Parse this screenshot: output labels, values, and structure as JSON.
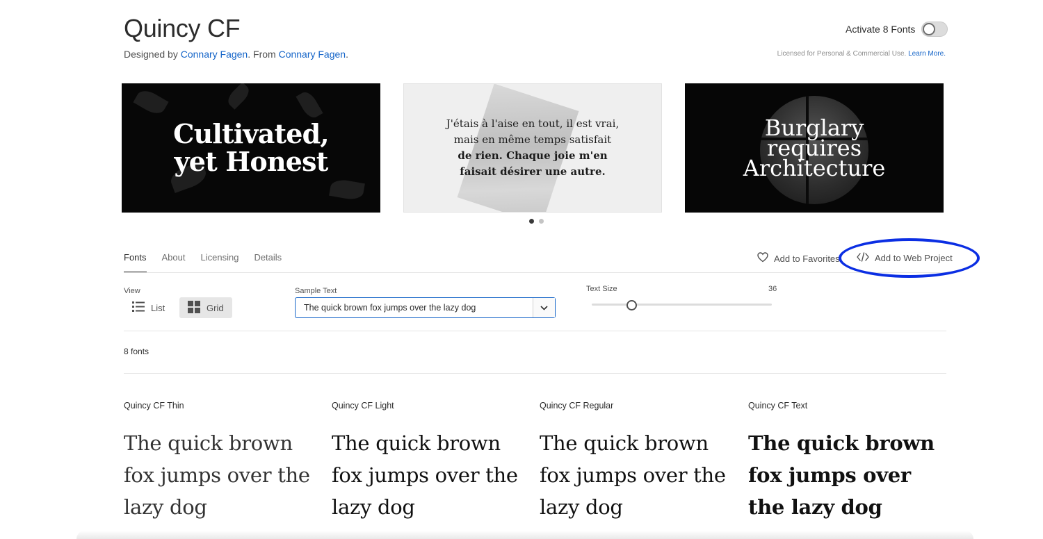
{
  "header": {
    "title": "Quincy CF",
    "designed_by_prefix": "Designed by ",
    "designer": "Connary Fagen",
    "from_prefix": ". From ",
    "foundry": "Connary Fagen",
    "suffix": ".",
    "activate_label": "Activate 8 Fonts",
    "activate_on": false,
    "license_text": "Licensed for Personal & Commercial Use. ",
    "learn_more": "Learn More."
  },
  "carousel": {
    "slides": [
      {
        "line1": "Cultivated,",
        "line2": "yet Honest"
      },
      {
        "line1": "J'étais à l'aise en tout, il est vrai,",
        "line2": "mais en même temps satisfait",
        "line3": "de rien. Chaque joie m'en",
        "line4": "faisait désirer une autre."
      },
      {
        "line1": "Burglary",
        "line2": "requires",
        "line3": "Architecture"
      }
    ],
    "page_count": 2,
    "active_page": 1
  },
  "tabs": [
    {
      "label": "Fonts",
      "active": true
    },
    {
      "label": "About",
      "active": false
    },
    {
      "label": "Licensing",
      "active": false
    },
    {
      "label": "Details",
      "active": false
    }
  ],
  "actions": {
    "favorites_label": "Add to Favorites",
    "web_project_label": "Add to Web Project"
  },
  "controls": {
    "view_label": "View",
    "list_label": "List",
    "grid_label": "Grid",
    "selected_view": "Grid",
    "sample_label": "Sample Text",
    "sample_value": "The quick brown fox jumps over the lazy dog",
    "text_size_label": "Text Size",
    "text_size_value": "36"
  },
  "font_count": "8 fonts",
  "fonts": [
    {
      "name": "Quincy CF Thin",
      "sample": "The quick brown fox jumps over the lazy dog"
    },
    {
      "name": "Quincy CF Light",
      "sample": "The quick brown fox jumps over the lazy dog"
    },
    {
      "name": "Quincy CF Regular",
      "sample": "The quick brown fox jumps over the lazy dog"
    },
    {
      "name": "Quincy CF Text",
      "sample": "The quick brown fox jumps over the lazy dog"
    }
  ],
  "colors": {
    "link": "#1464c8",
    "annotation": "#0b2ee3",
    "text": "#2c2c2c"
  },
  "icons": [
    "heart-icon",
    "code-icon",
    "list-view-icon",
    "grid-view-icon",
    "chevron-down-icon"
  ]
}
